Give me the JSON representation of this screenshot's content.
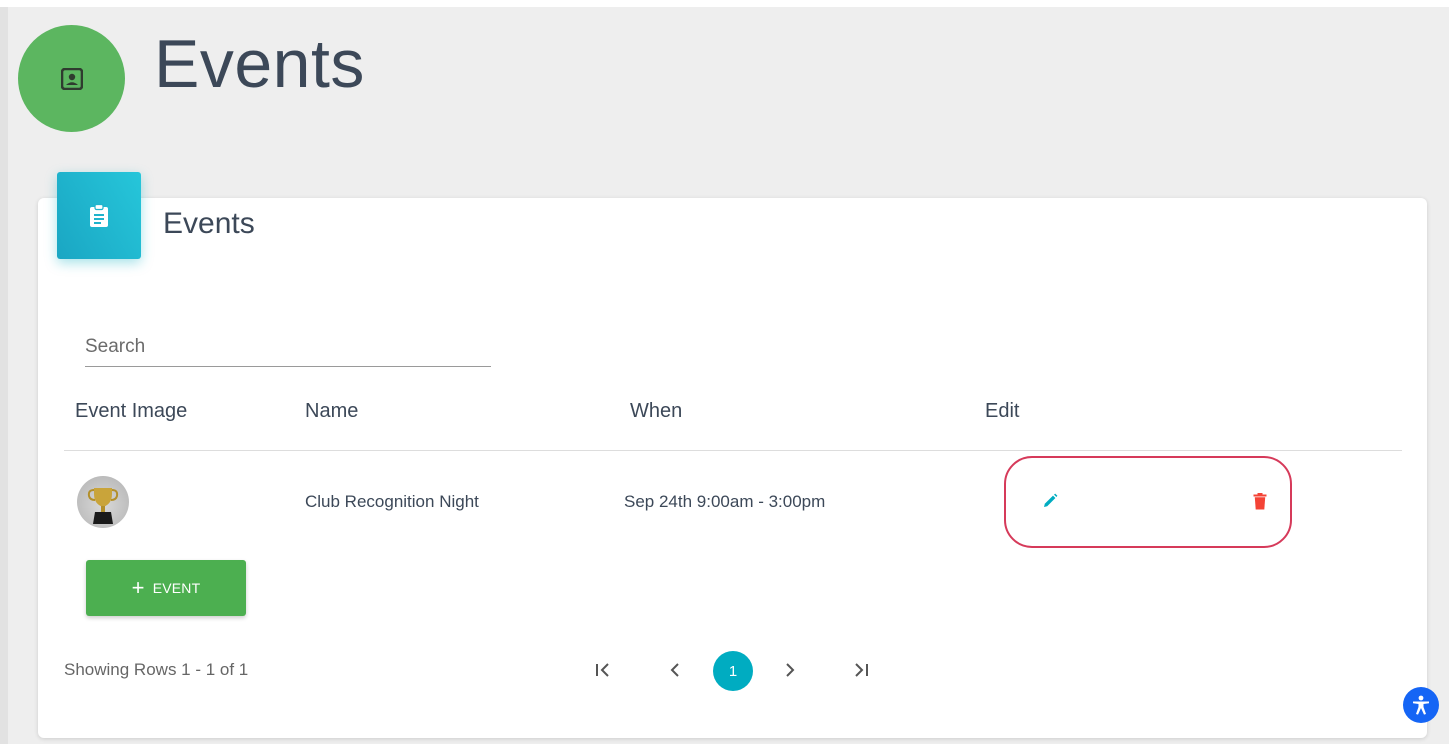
{
  "page": {
    "title": "Events"
  },
  "card": {
    "title": "Events"
  },
  "search": {
    "placeholder": "Search",
    "value": ""
  },
  "table": {
    "columns": [
      "Event Image",
      "Name",
      "When",
      "Edit"
    ],
    "rows": [
      {
        "name": "Club Recognition Night",
        "when": "Sep 24th 9:00am - 3:00pm"
      }
    ]
  },
  "actions": {
    "add_event_plus": "+",
    "add_event_label": "EVENT"
  },
  "pagination": {
    "showing": "Showing Rows 1 - 1 of 1",
    "first": "|<",
    "prev": "<",
    "current": "1",
    "next": ">",
    "last": ">|"
  },
  "colors": {
    "page_icon": "#5cb660",
    "card_icon": "#26c6da",
    "edit": "#00acc1",
    "delete": "#f44336",
    "add_button": "#4caf50",
    "highlight": "#d63a5a"
  },
  "icons": {
    "page": "contact-card-icon",
    "card": "clipboard-icon",
    "edit": "pencil-icon",
    "delete": "trash-icon",
    "accessibility": "accessibility-icon"
  }
}
